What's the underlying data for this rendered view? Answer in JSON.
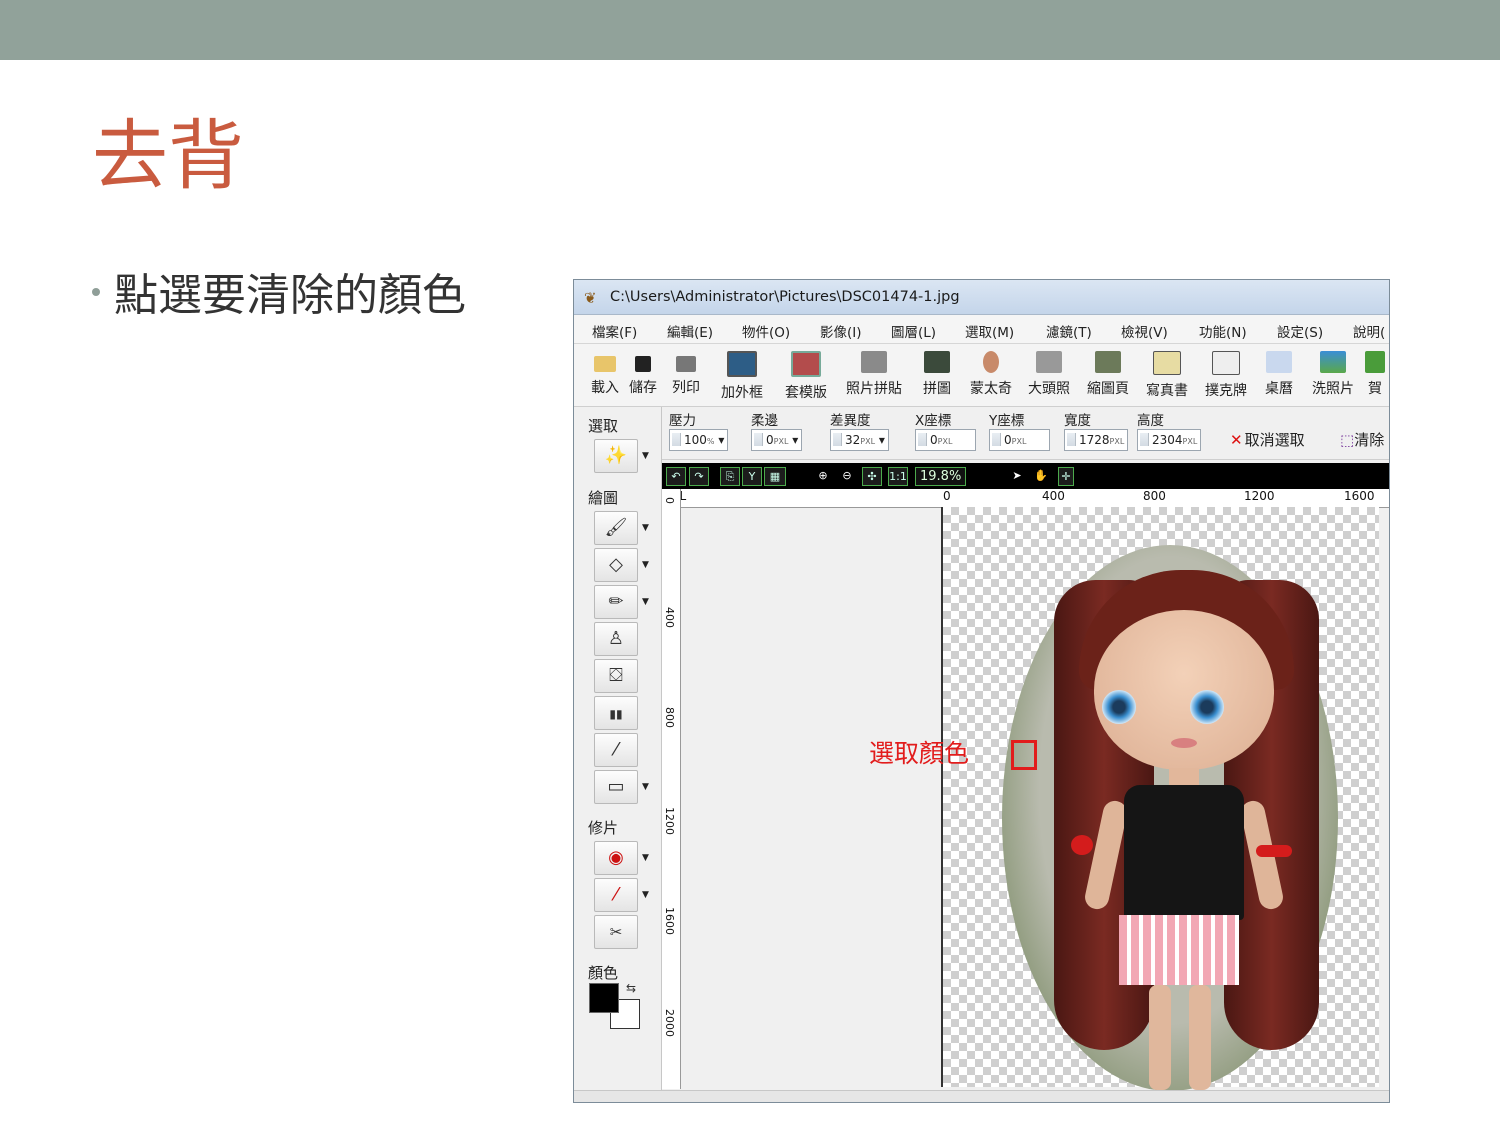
{
  "slide": {
    "title": "去背",
    "bullet": "點選要清除的顏色"
  },
  "window": {
    "title": "C:\\Users\\Administrator\\Pictures\\DSC01474-1.jpg",
    "menu": [
      "檔案(F)",
      "編輯(E)",
      "物件(O)",
      "影像(I)",
      "圖層(L)",
      "選取(M)",
      "濾鏡(T)",
      "檢視(V)",
      "功能(N)",
      "設定(S)",
      "說明("
    ],
    "toolbar": [
      "載入",
      "儲存",
      "列印",
      "加外框",
      "套模版",
      "照片拼貼",
      "拼圖",
      "蒙太奇",
      "大頭照",
      "縮圖頁",
      "寫真書",
      "撲克牌",
      "桌曆",
      "洗照片",
      "賀"
    ],
    "options": {
      "pressure": {
        "label": "壓力",
        "value": "100",
        "unit": "%"
      },
      "feather": {
        "label": "柔邊",
        "value": "0",
        "unit": "PXL"
      },
      "tolerance": {
        "label": "差異度",
        "value": "32",
        "unit": "PXL"
      },
      "x": {
        "label": "X座標",
        "value": "0",
        "unit": "PXL"
      },
      "y": {
        "label": "Y座標",
        "value": "0",
        "unit": "PXL"
      },
      "width": {
        "label": "寬度",
        "value": "1728",
        "unit": "PXL"
      },
      "height": {
        "label": "高度",
        "value": "2304",
        "unit": "PXL"
      },
      "cancel_selection": "取消選取",
      "clear": "清除"
    },
    "left_panel": {
      "select_label": "選取",
      "draw_label": "繪圖",
      "retouch_label": "修片",
      "color_label": "顏色"
    },
    "view": {
      "zoom": "19.8%",
      "ruler_unit": "PXL",
      "h_ticks": [
        "0",
        "400",
        "800",
        "1200",
        "1600"
      ],
      "v_ticks": [
        "0",
        "400",
        "800",
        "1200",
        "1600",
        "2000"
      ]
    },
    "annotation": "選取顏色",
    "colors": {
      "foreground": "#000000",
      "background": "#ffffff"
    }
  }
}
